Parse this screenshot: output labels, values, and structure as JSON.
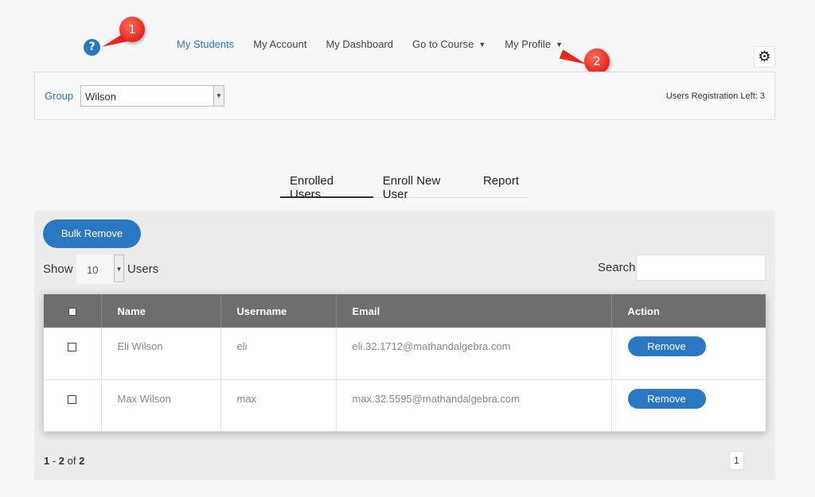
{
  "nav": {
    "items": [
      {
        "label": "My Students",
        "active": true,
        "dropdown": false
      },
      {
        "label": "My Account",
        "active": false,
        "dropdown": false
      },
      {
        "label": "My Dashboard",
        "active": false,
        "dropdown": false
      },
      {
        "label": "Go to Course",
        "active": false,
        "dropdown": true
      },
      {
        "label": "My Profile",
        "active": false,
        "dropdown": true
      }
    ],
    "help_glyph": "?",
    "gear_glyph": "⚙"
  },
  "callouts": {
    "one": "1",
    "two": "2"
  },
  "group": {
    "label": "Group",
    "selected": "Wilson",
    "registration_left": "Users Registration Left: 3"
  },
  "tabs": [
    {
      "label": "Enrolled Users",
      "active": true
    },
    {
      "label": "Enroll New User",
      "active": false
    },
    {
      "label": "Report",
      "active": false
    }
  ],
  "panel": {
    "bulk_remove_label": "Bulk Remove",
    "show_label": "Show",
    "show_value": "10",
    "users_label": "Users",
    "search_label": "Search",
    "search_value": ""
  },
  "table": {
    "columns": [
      "Name",
      "Username",
      "Email",
      "Action"
    ],
    "rows": [
      {
        "name": "Eli Wilson",
        "username": "eli",
        "email": "eli.32.1712@mathandalgebra.com",
        "action": "Remove"
      },
      {
        "name": "Max Wilson",
        "username": "max",
        "email": "max.32.5595@mathandalgebra.com",
        "action": "Remove"
      }
    ]
  },
  "pagination": {
    "range_start": "1",
    "range_sep": " - ",
    "range_end": "2",
    "of_label": " of ",
    "total": "2",
    "current_page": "1"
  },
  "colors": {
    "accent": "#2a78c2",
    "callout": "#e8261c",
    "header": "#6e6e6e"
  }
}
